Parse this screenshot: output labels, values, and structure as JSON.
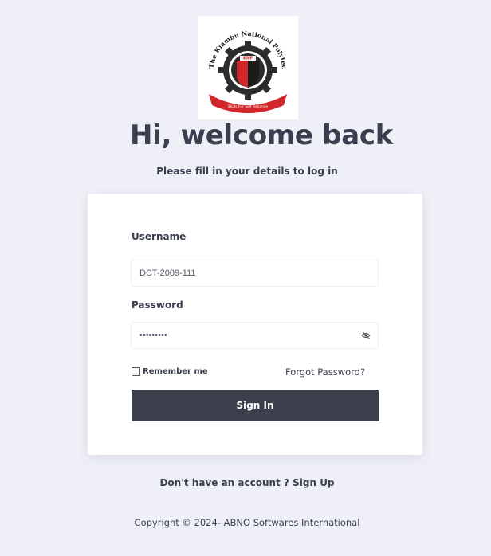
{
  "logo": {
    "ring_text": "The Kiambu National Polytechnic",
    "center_text": "KNP",
    "banner_text": "Skills For Self Reliance"
  },
  "header": {
    "title": "Hi, welcome back",
    "subtitle": "Please fill in your details to log in"
  },
  "form": {
    "username_label": "Username",
    "username_value": "DCT-2009-111",
    "password_label": "Password",
    "password_value": "•••••••••",
    "remember_label": "Remember me",
    "forgot_label": "Forgot Password?",
    "signin_label": "Sign In"
  },
  "footer": {
    "signup_prefix": "Don't have an account ?",
    "signup_link": "Sign Up",
    "copyright": "Copyright © 2024- ABNO Softwares International"
  },
  "colors": {
    "background": "#eff0f7",
    "button": "#3b3e4b",
    "text": "#3a3f4f",
    "logo_red": "#d3262b"
  }
}
